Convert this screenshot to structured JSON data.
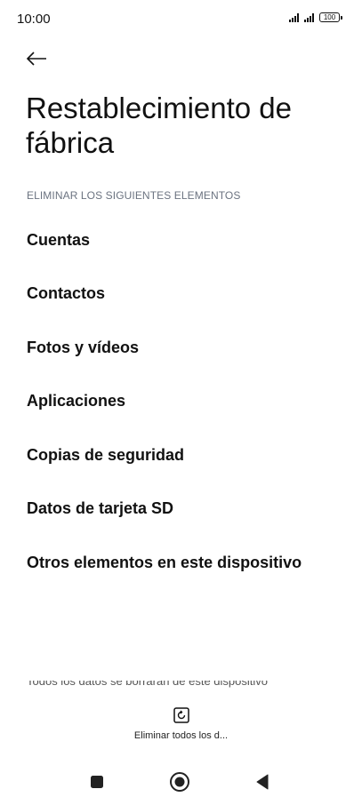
{
  "status_bar": {
    "time": "10:00",
    "battery_level": "100",
    "icons": [
      "signal-icon",
      "signal-icon",
      "battery-icon"
    ]
  },
  "header": {
    "back_icon": "back-arrow-icon",
    "title": "Restablecimiento de fábrica"
  },
  "section": {
    "header": "ELIMINAR LOS SIGUIENTES ELEMENTOS",
    "items": [
      {
        "label": "Cuentas"
      },
      {
        "label": "Contactos"
      },
      {
        "label": "Fotos y vídeos"
      },
      {
        "label": "Aplicaciones"
      },
      {
        "label": "Copias de seguridad"
      },
      {
        "label": "Datos de tarjeta SD"
      },
      {
        "label": "Otros elementos en este dispositivo"
      }
    ]
  },
  "footer_note": "Todos los datos se borrarán de este dispositivo",
  "bottom_action": {
    "icon": "reset-icon",
    "label": "Eliminar todos los d..."
  },
  "nav_bar": {
    "icons": [
      "recents-square-icon",
      "home-circle-icon",
      "back-triangle-icon"
    ]
  },
  "colors": {
    "text": "#111111",
    "section_header": "#6b7380",
    "background": "#ffffff"
  }
}
